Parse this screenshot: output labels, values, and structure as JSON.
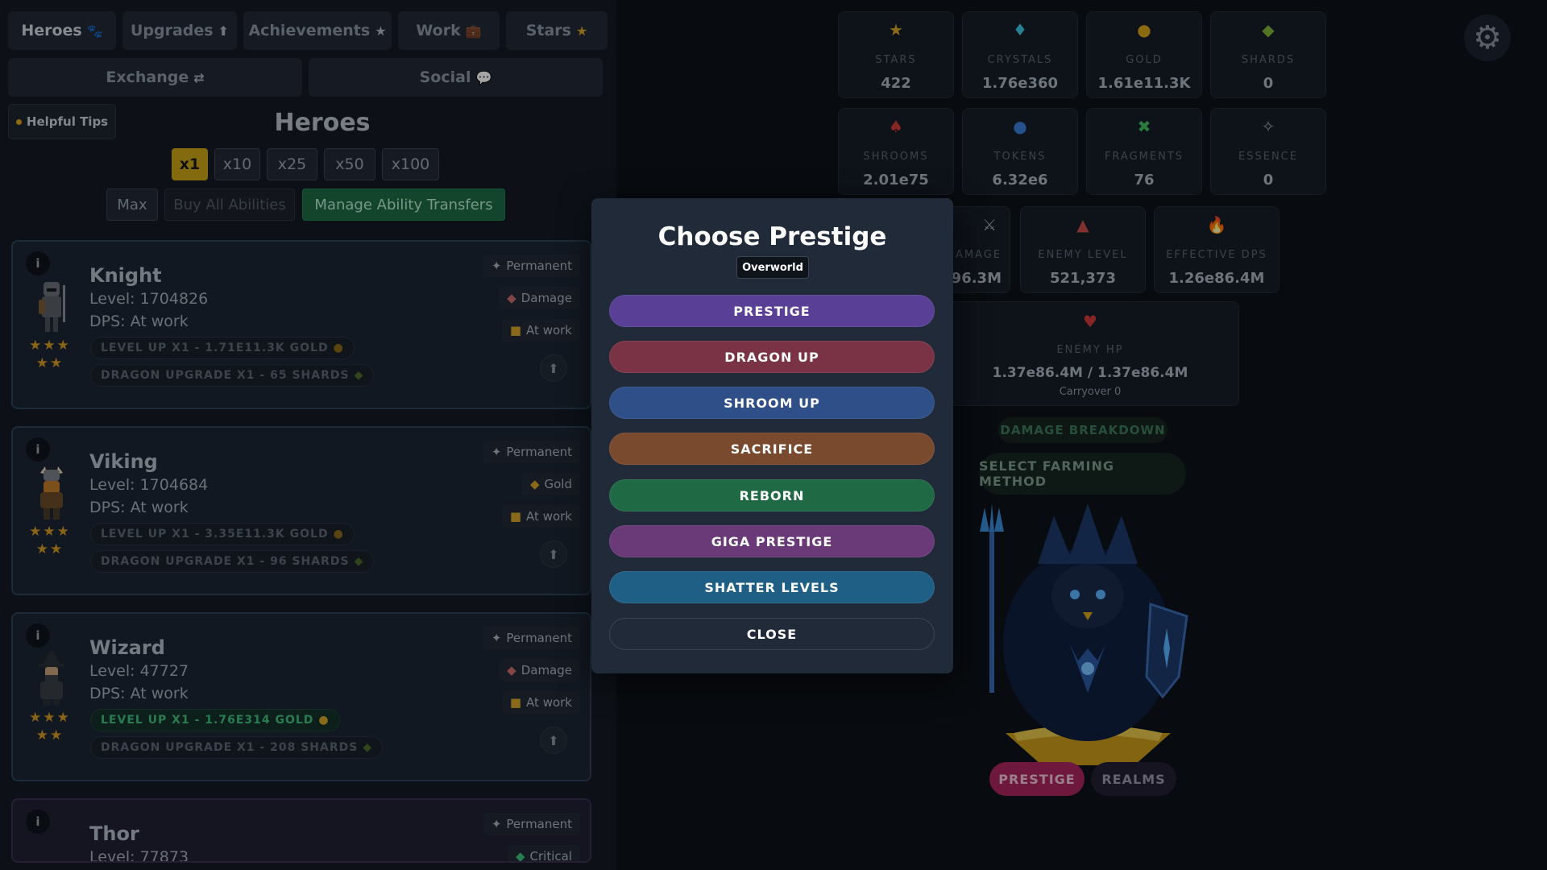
{
  "tabs_row1": [
    {
      "label": "Heroes",
      "icon": "paw-icon",
      "glyph": "🐾"
    },
    {
      "label": "Upgrades",
      "icon": "arrow-up-circle-icon",
      "glyph": "⬆"
    },
    {
      "label": "Achievements",
      "icon": "star-icon",
      "glyph": "★"
    },
    {
      "label": "Work",
      "icon": "briefcase-icon",
      "glyph": "💼"
    },
    {
      "label": "Stars",
      "icon": "star-icon",
      "glyph": "★"
    }
  ],
  "tabs_row2": [
    {
      "label": "Exchange",
      "icon": "exchange-icon",
      "glyph": "⇄"
    },
    {
      "label": "Social",
      "icon": "chat-icon",
      "glyph": "💬"
    }
  ],
  "tips_label": "Helpful Tips",
  "heroes_title": "Heroes",
  "multipliers": [
    "x1",
    "x10",
    "x25",
    "x50",
    "x100"
  ],
  "selected_multiplier": "x1",
  "max_label": "Max",
  "buy_all_label": "Buy All Abilities",
  "manage_label": "Manage Ability Transfers",
  "heroes": [
    {
      "name": "Knight",
      "level": "Level: 1704826",
      "dps": "DPS: At work",
      "stars": "★★★ ★★",
      "tag_perm": "Permanent",
      "tag_type": "Damage",
      "tag_work": "At work",
      "levelup": "LEVEL UP X1 - 1.71E11.3K GOLD",
      "dragon": "DRAGON UPGRADE X1 - 65 SHARDS",
      "levelup_ok": false
    },
    {
      "name": "Viking",
      "level": "Level: 1704684",
      "dps": "DPS: At work",
      "stars": "★★★ ★★",
      "tag_perm": "Permanent",
      "tag_type": "Gold",
      "tag_work": "At work",
      "levelup": "LEVEL UP X1 - 3.35E11.3K GOLD",
      "dragon": "DRAGON UPGRADE X1 - 96 SHARDS",
      "levelup_ok": false
    },
    {
      "name": "Wizard",
      "level": "Level: 47727",
      "dps": "DPS: At work",
      "stars": "★★★ ★★",
      "tag_perm": "Permanent",
      "tag_type": "Damage",
      "tag_work": "At work",
      "levelup": "LEVEL UP X1 - 1.76E314 GOLD",
      "dragon": "DRAGON UPGRADE X1 - 208 SHARDS",
      "levelup_ok": true
    },
    {
      "name": "Thor",
      "level": "Level: 77873",
      "tag_perm": "Permanent",
      "tag_type": "Critical"
    }
  ],
  "stats_row1": [
    {
      "label": "STARS",
      "value": "422",
      "glyph": "★",
      "color": "#d4a12a",
      "icon": "star-icon"
    },
    {
      "label": "CRYSTALS",
      "value": "1.76e360",
      "glyph": "♦",
      "color": "#3ec6e0",
      "icon": "crystal-icon"
    },
    {
      "label": "GOLD",
      "value": "1.61e11.3K",
      "glyph": "●",
      "color": "#d8a31c",
      "icon": "gold-bag-icon"
    },
    {
      "label": "SHARDS",
      "value": "0",
      "glyph": "◆",
      "color": "#7fb23a",
      "icon": "shard-icon"
    }
  ],
  "stats_row2": [
    {
      "label": "SHROOMS",
      "value": "2.01e75",
      "glyph": "♠",
      "color": "#d23a3a",
      "icon": "mushroom-icon"
    },
    {
      "label": "TOKENS",
      "value": "6.32e6",
      "glyph": "●",
      "color": "#3a7fd8",
      "icon": "token-icon"
    },
    {
      "label": "FRAGMENTS",
      "value": "76",
      "glyph": "✖",
      "color": "#3fbf5f",
      "icon": "fragment-icon"
    },
    {
      "label": "ESSENCE",
      "value": "0",
      "glyph": "✧",
      "color": "#9aa3af",
      "icon": "essence-icon"
    }
  ],
  "stats_row3": [
    {
      "label": "AMAGE",
      "value": "96.3M",
      "glyph": "⚔",
      "color": "#9aa3af",
      "icon": "damage-icon"
    },
    {
      "label": "ENEMY LEVEL",
      "value": "521,373",
      "glyph": "▲",
      "color": "#c94a4a",
      "icon": "chart-up-icon"
    },
    {
      "label": "EFFECTIVE DPS",
      "value": "1.26e86.4M",
      "glyph": "🔥",
      "color": "#e0692a",
      "icon": "fire-icon"
    }
  ],
  "enemy_hp": {
    "label": "ENEMY HP",
    "value": "1.37e86.4M / 1.37e86.4M",
    "carryover": "Carryover 0"
  },
  "damage_breakdown": "DAMAGE BREAKDOWN",
  "farming_label": "SELECT FARMING METHOD",
  "bottom_prestige": "PRESTIGE",
  "bottom_realms": "REALMS",
  "modal": {
    "title": "Choose Prestige",
    "realm": "Overworld",
    "buttons": [
      {
        "label": "PRESTIGE",
        "color": "#5a3f96"
      },
      {
        "label": "DRAGON UP",
        "color": "#7a3344"
      },
      {
        "label": "SHROOM UP",
        "color": "#2e4f87"
      },
      {
        "label": "SACRIFICE",
        "color": "#7a4a2e"
      },
      {
        "label": "REBORN",
        "color": "#1f6a45"
      },
      {
        "label": "GIGA PRESTIGE",
        "color": "#6a3a78"
      },
      {
        "label": "SHATTER LEVELS",
        "color": "#1f5f86"
      },
      {
        "label": "CLOSE",
        "color": "#212a38"
      }
    ]
  }
}
